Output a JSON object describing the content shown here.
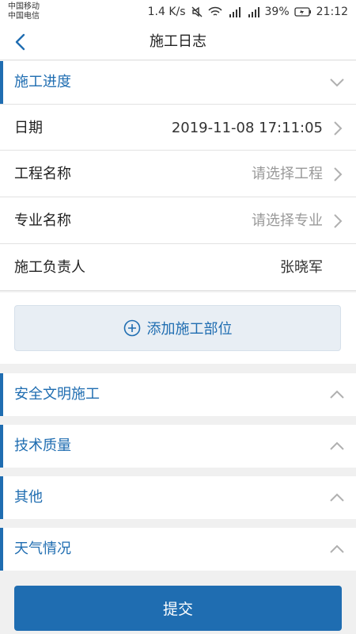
{
  "status_bar": {
    "carrier1": "中国移动",
    "carrier2": "中国电信",
    "speed": "1.4 K/s",
    "battery": "39%",
    "time": "21:12"
  },
  "header": {
    "title": "施工日志"
  },
  "sections": {
    "progress": "施工进度",
    "safety": "安全文明施工",
    "quality": "技术质量",
    "other": "其他",
    "weather": "天气情况"
  },
  "rows": {
    "date": {
      "label": "日期",
      "value": "2019-11-08 17:11:05"
    },
    "project": {
      "label": "工程名称",
      "placeholder": "请选择工程"
    },
    "specialty": {
      "label": "专业名称",
      "placeholder": "请选择专业"
    },
    "manager": {
      "label": "施工负责人",
      "value": "张晓军"
    }
  },
  "add_part_label": "添加施工部位",
  "submit_label": "提交",
  "colors": {
    "accent": "#1f6db1",
    "add_bg": "#e8eef4"
  }
}
